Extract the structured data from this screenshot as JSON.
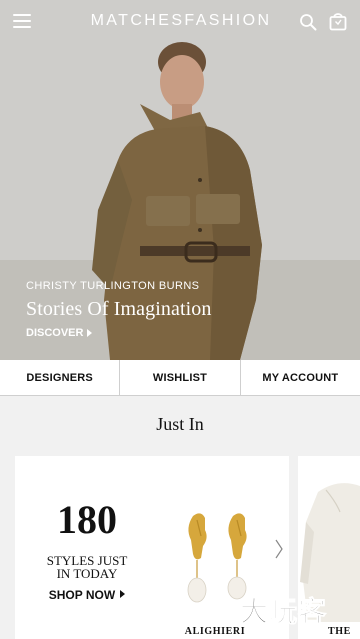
{
  "header": {
    "logo": "MATCHESFASHION",
    "menu_icon": "hamburger-menu-icon",
    "search_icon": "search-icon",
    "bag_icon": "shopping-bag-icon"
  },
  "hero": {
    "eyebrow": "CHRISTY TURLINGTON BURNS",
    "title": "Stories Of Imagination",
    "cta": "DISCOVER"
  },
  "tabs": [
    {
      "label": "DESIGNERS"
    },
    {
      "label": "WISHLIST"
    },
    {
      "label": "MY ACCOUNT"
    }
  ],
  "just_in": {
    "title": "Just In",
    "count": "180",
    "subtitle_line1": "STYLES JUST",
    "subtitle_line2": "IN TODAY",
    "cta": "SHOP NOW",
    "products": [
      {
        "brand": "ALIGHIERI"
      },
      {
        "brand": "THE"
      }
    ]
  },
  "watermark": "大玩客",
  "colors": {
    "accent": "#111111",
    "hero_bg": "#c9c8c4",
    "section_bg": "#f1f1f1",
    "divider": "#cfcfcf"
  }
}
